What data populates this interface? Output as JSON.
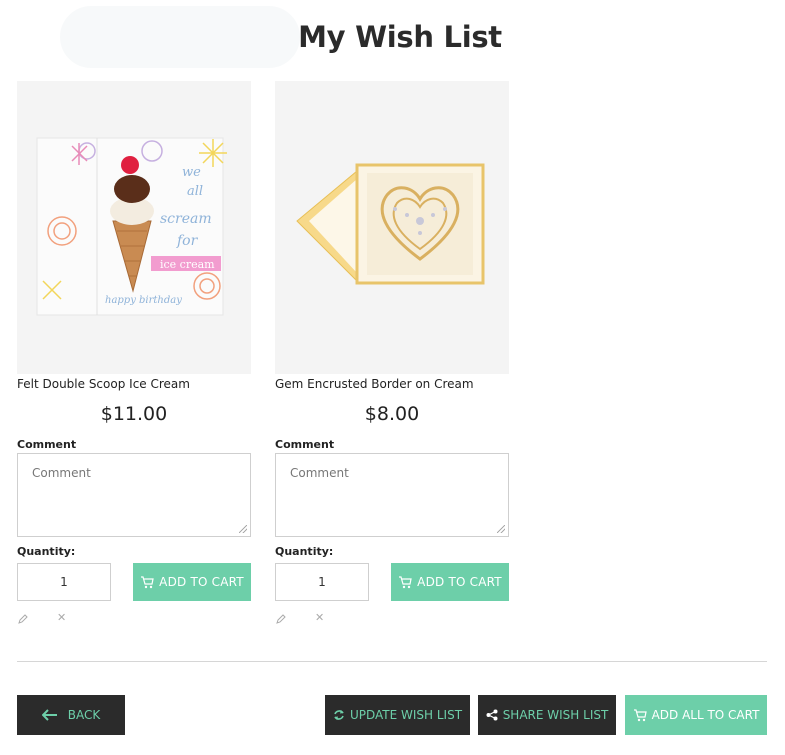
{
  "page": {
    "title": "My Wish List"
  },
  "items": [
    {
      "name": "Felt Double Scoop Ice Cream",
      "price": "$11.00",
      "comment_label": "Comment",
      "comment_placeholder": "Comment",
      "quantity_label": "Quantity:",
      "quantity": "1",
      "add_to_cart_label": "ADD TO CART",
      "card_text": {
        "we": "we",
        "all": "all",
        "scream": "scream",
        "for": "for",
        "ice_cream": "ice cream",
        "happy_birthday": "happy birthday"
      }
    },
    {
      "name": "Gem Encrusted Border on Cream",
      "price": "$8.00",
      "comment_label": "Comment",
      "comment_placeholder": "Comment",
      "quantity_label": "Quantity:",
      "quantity": "1",
      "add_to_cart_label": "ADD TO CART"
    }
  ],
  "actions": {
    "back": "BACK",
    "update": "UPDATE WISH LIST",
    "share": "SHARE WISH LIST",
    "add_all": "ADD ALL TO CART"
  },
  "colors": {
    "accent": "#6dcfa9",
    "dark": "#2b2b2b",
    "image_bg": "#f4f4f4"
  },
  "icons": [
    "cart-icon",
    "edit-icon",
    "remove-icon",
    "back-arrow-icon",
    "refresh-icon",
    "share-icon"
  ]
}
